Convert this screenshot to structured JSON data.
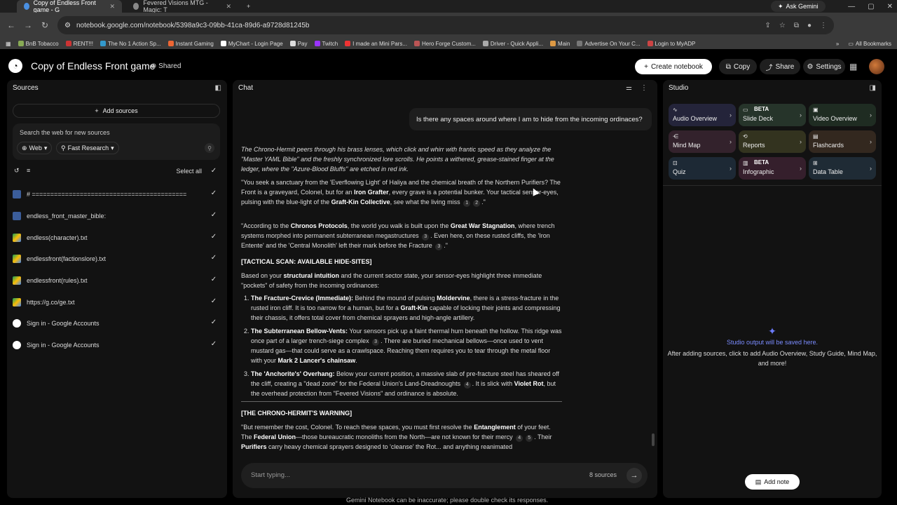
{
  "browser": {
    "tabs": [
      {
        "title": "Copy of Endless Front game - G",
        "active": true
      },
      {
        "title": "Fevered Visions MTG - Magic: T",
        "active": false
      }
    ],
    "ask_gemini": "Ask Gemini",
    "url": "notebook.google.com/notebook/5398a9c3-09bb-41ca-89d6-a9728d81245b",
    "bookmarks": [
      "BnB Tobacco",
      "RENT!!!",
      "The No 1 Action Sp...",
      "Instant Gaming",
      "MyChart - Login Page",
      "Pay",
      "Twitch",
      "I made an Mini Pars...",
      "Hero Forge Custom...",
      "Driver - Quick Appli...",
      "Main",
      "Advertise On Your C...",
      "Login to MyADP"
    ],
    "all_bookmarks": "All Bookmarks"
  },
  "header": {
    "title": "Copy of Endless Front game",
    "shared": "Shared",
    "create_notebook": "Create notebook",
    "copy": "Copy",
    "share": "Share",
    "settings": "Settings"
  },
  "sources": {
    "title": "Sources",
    "add_sources": "Add sources",
    "search_placeholder": "Search the web for new sources",
    "chip_web": "Web",
    "chip_research": "Fast Research",
    "select_all": "Select all",
    "items": [
      {
        "label": "# ==========================================",
        "icon": "text-file-icon"
      },
      {
        "label": "endless_front_master_bible:",
        "icon": "text-file-icon"
      },
      {
        "label": "endless(character).txt",
        "icon": "drive-icon"
      },
      {
        "label": "endlessfront(factionslore).txt",
        "icon": "drive-icon"
      },
      {
        "label": "endlessfront(rules).txt",
        "icon": "drive-icon"
      },
      {
        "label": "https://g.co/ge.txt",
        "icon": "drive-icon"
      },
      {
        "label": "Sign in - Google Accounts",
        "icon": "google-icon"
      },
      {
        "label": "Sign in - Google Accounts",
        "icon": "google-icon"
      }
    ]
  },
  "chat": {
    "title": "Chat",
    "user_message": "Is there any spaces around where I am to hide from the incoming ordinaces?",
    "intro": "The Chrono-Hermit peers through his brass lenses, which click and whirr with frantic speed as they analyze the \"Master YAML Bible\" and the freshly synchronized lore scrolls. He points a withered, grease-stained finger at the ledger, where the \"Azure-Blood Bluffs\" are etched in red ink.",
    "section_scan": "[TACTICAL SCAN: AVAILABLE HIDE-SITES]",
    "section_warning": "[THE CHRONO-HERMIT'S WARNING]",
    "input_placeholder": "Start typing...",
    "source_count": "8 sources",
    "footer": "Gemini Notebook can be inaccurate; please double check its responses."
  },
  "studio": {
    "title": "Studio",
    "tools": [
      {
        "label": "Audio Overview",
        "icon": "waveform-icon",
        "beta": ""
      },
      {
        "label": "Slide Deck",
        "icon": "slides-icon",
        "beta": "BETA"
      },
      {
        "label": "Video Overview",
        "icon": "video-icon",
        "beta": ""
      },
      {
        "label": "Mind Map",
        "icon": "mindmap-icon",
        "beta": ""
      },
      {
        "label": "Reports",
        "icon": "reports-icon",
        "beta": ""
      },
      {
        "label": "Flashcards",
        "icon": "flashcards-icon",
        "beta": ""
      },
      {
        "label": "Quiz",
        "icon": "quiz-icon",
        "beta": ""
      },
      {
        "label": "Infographic",
        "icon": "infographic-icon",
        "beta": "BETA"
      },
      {
        "label": "Data Table",
        "icon": "table-icon",
        "beta": ""
      }
    ],
    "empty_title": "Studio output will be saved here.",
    "empty_body": "After adding sources, click to add Audio Overview, Study Guide, Mind Map, and more!",
    "add_note": "Add note"
  },
  "colors": {
    "audio": "#2a2a3e",
    "slides": "#2a3a2a",
    "video": "#223024",
    "mindmap": "#3a2632",
    "reports": "#3a3a22",
    "flashcards": "#3a2d22",
    "quiz": "#1f2d3a",
    "infographic": "#3a2230",
    "datatable": "#22303a"
  }
}
